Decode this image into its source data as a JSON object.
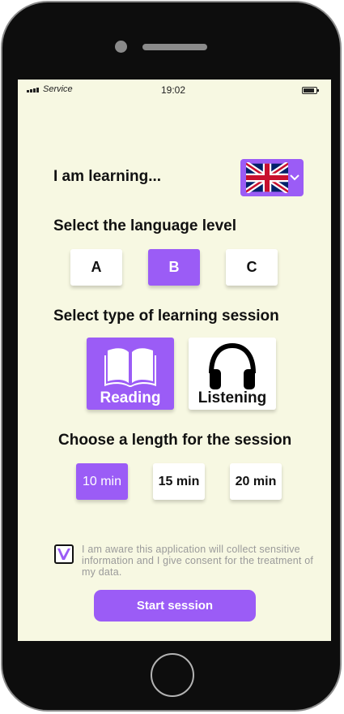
{
  "status_bar": {
    "carrier": "Service",
    "time": "19:02"
  },
  "learning": {
    "label": "I am learning...",
    "selected_language_icon": "uk-flag-icon",
    "dropdown_icon": "chevron-down-icon"
  },
  "level": {
    "label": "Select the language level",
    "options": [
      "A",
      "B",
      "C"
    ],
    "selected": "B"
  },
  "session_type": {
    "label": "Select type of learning session",
    "options": [
      {
        "label": "Reading",
        "icon": "book-icon"
      },
      {
        "label": "Listening",
        "icon": "headphones-icon"
      }
    ],
    "selected": "Reading"
  },
  "length": {
    "label": "Choose a length for the session",
    "options": [
      "10 min",
      "15 min",
      "20 min"
    ],
    "selected": "10 min"
  },
  "consent": {
    "checked": true,
    "text": "I am aware this application will collect sensitive information and I give consent for the treatment of my data."
  },
  "start_button": {
    "label": "Start session"
  },
  "colors": {
    "accent": "#9b5cf6",
    "screen_background": "#f7f8e2",
    "frame": "#0d0d0d"
  }
}
